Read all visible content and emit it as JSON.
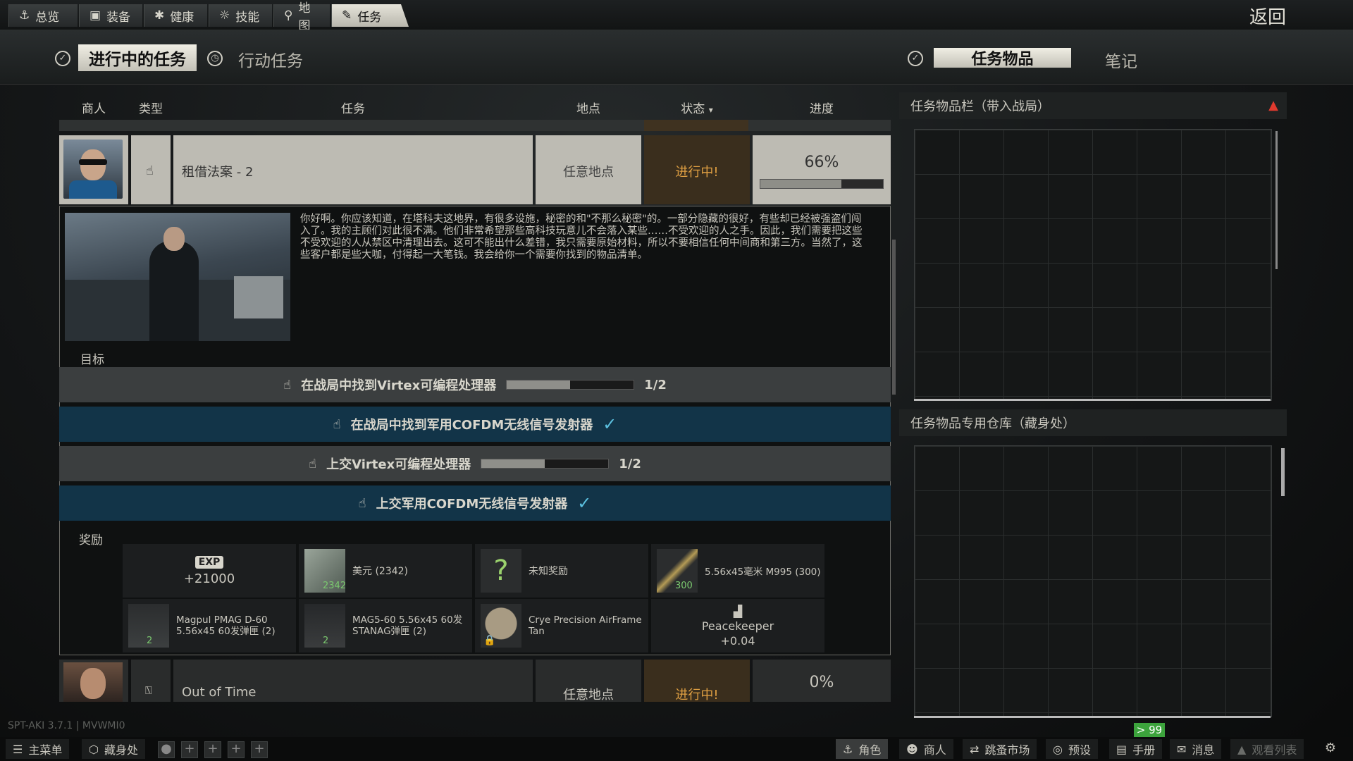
{
  "top_tabs": [
    "总览",
    "装备",
    "健康",
    "技能",
    "地图",
    "任务"
  ],
  "back_label": "返回",
  "quest_tabs": {
    "active": "进行中的任务",
    "other": "行动任务"
  },
  "right_tabs": {
    "active": "任务物品",
    "other": "笔记"
  },
  "columns": {
    "trader": "商人",
    "type": "类型",
    "task": "任务",
    "location": "地点",
    "status": "状态",
    "progress": "进度"
  },
  "quest": {
    "title": "租借法案 - 2",
    "location": "任意地点",
    "status": "进行中!",
    "progress_text": "66%",
    "progress_value": 0.66,
    "description": "你好啊。你应该知道，在塔科夫这地界，有很多设施，秘密的和\"不那么秘密\"的。一部分隐藏的很好，有些却已经被强盗们闯入了。我的主顾们对此很不满。他们非常希望那些高科技玩意儿不会落入某些……不受欢迎的人之手。因此，我们需要把这些不受欢迎的人从禁区中清理出去。这可不能出什么差错，我只需要原始材料，所以不要相信任何中间商和第三方。当然了，这些客户都是些大咖，付得起一大笔钱。我会给你一个需要你找到的物品清单。",
    "objectives_label": "目标",
    "objectives": [
      {
        "text": "在战局中找到Virtex可编程处理器",
        "count": "1/2",
        "progress": 0.5,
        "done": false
      },
      {
        "text": "在战局中找到军用COFDM无线信号发射器",
        "done": true
      },
      {
        "text": "上交Virtex可编程处理器",
        "count": "1/2",
        "progress": 0.5,
        "done": false
      },
      {
        "text": "上交军用COFDM无线信号发射器",
        "done": true
      }
    ],
    "rewards_label": "奖励",
    "rewards": {
      "exp_badge": "EXP",
      "exp": "+21000",
      "dollars": "美元 (2342)",
      "dollars_count": "2342",
      "unknown": "未知奖励",
      "unknown_mark": "?",
      "ammo": "5.56x45毫米 M995 (300)",
      "ammo_count": "300",
      "mag1_line1": "Magpul PMAG D-60",
      "mag1_line2": "5.56x45 60发弹匣 (2)",
      "mag1_count": "2",
      "mag2_line1": "MAG5-60 5.56x45 60发",
      "mag2_line2": "STANAG弹匣 (2)",
      "mag2_count": "2",
      "helmet_line1": "Crye Precision AirFrame",
      "helmet_line2": "Tan",
      "rep_name": "Peacekeeper",
      "rep_value": "+0.04"
    }
  },
  "quest2": {
    "title": "Out of Time",
    "location": "任意地点",
    "status": "进行中!",
    "progress_text": "0%"
  },
  "right_panel": {
    "stash_title": "任务物品栏（带入战局）",
    "store_title": "任务物品专用仓库（藏身处）",
    "count_badge": "> 99"
  },
  "version": "SPT-AKI 3.7.1 | MVWMI0",
  "bottom_left": [
    "主菜单",
    "藏身处"
  ],
  "bottom_right": [
    "角色",
    "商人",
    "跳蚤市场",
    "预设",
    "手册",
    "消息",
    "观看列表"
  ],
  "colors": {
    "accent_status": "#e0a043",
    "objective_blue": "#123448",
    "check": "#5cc1e0",
    "warning": "#e03a2e"
  }
}
